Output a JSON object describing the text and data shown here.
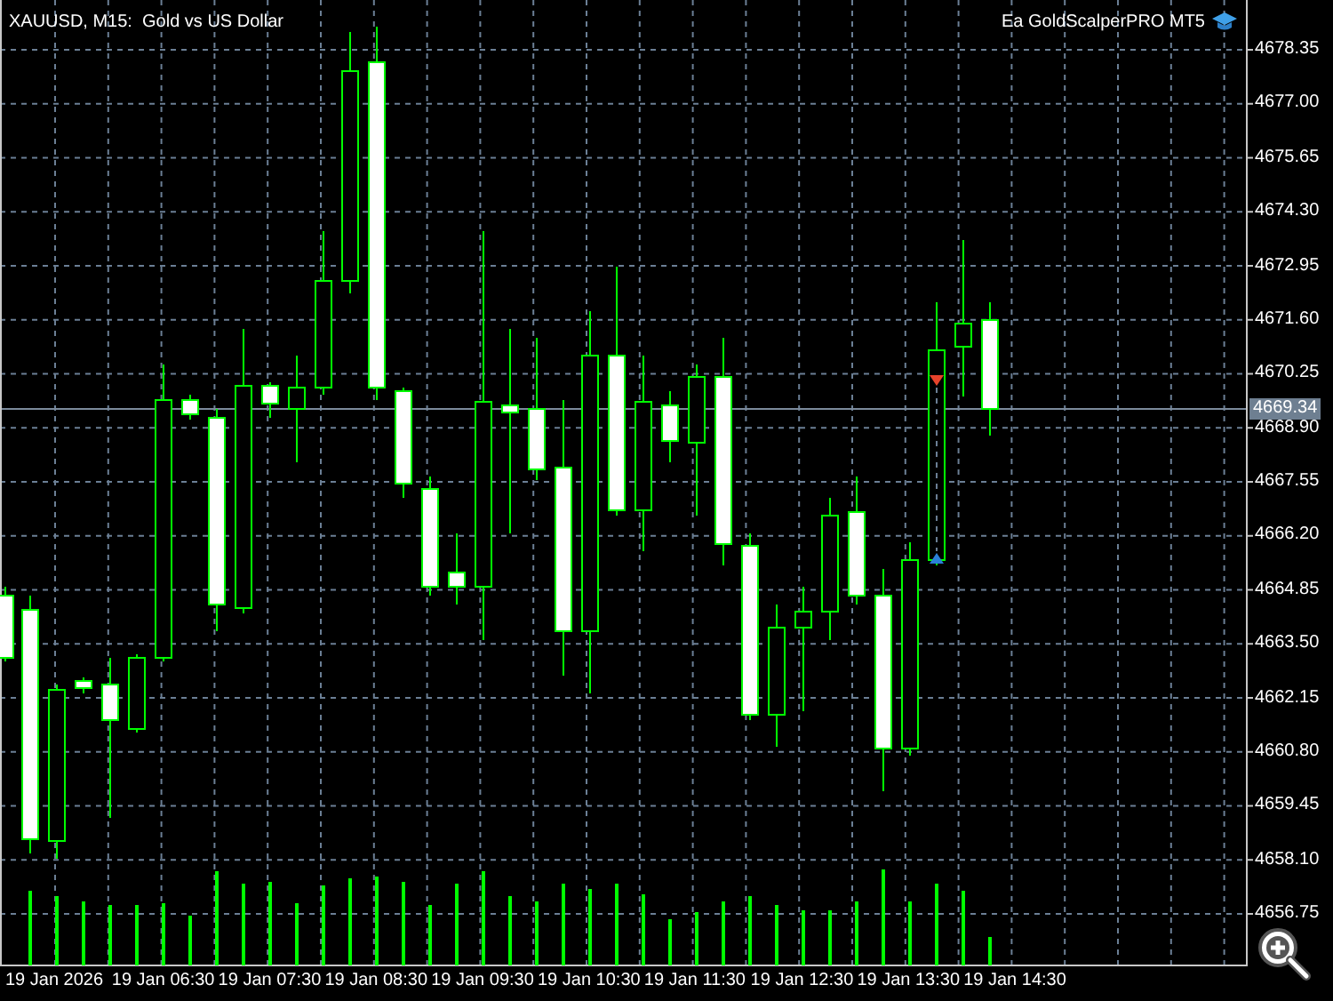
{
  "chart": {
    "title": "XAUUSD, M15:  Gold vs US Dollar",
    "expert_advisor": "Ea GoldScalperPRO MT5",
    "price_axis": [
      "4678.35",
      "4677.00",
      "4675.65",
      "4674.30",
      "4672.95",
      "4671.60",
      "4670.25",
      "4668.90",
      "4667.55",
      "4666.20",
      "4664.85",
      "4663.50",
      "4662.15",
      "4660.80",
      "4659.45",
      "4658.10",
      "4656.75"
    ],
    "current_price": "4669.34",
    "time_axis": [
      "19 Jan 2026",
      "19 Jan 06:30",
      "19 Jan 07:30",
      "19 Jan 08:30",
      "19 Jan 09:30",
      "19 Jan 10:30",
      "19 Jan 11:30",
      "19 Jan 12:30",
      "19 Jan 13:30",
      "19 Jan 14:30"
    ]
  }
}
